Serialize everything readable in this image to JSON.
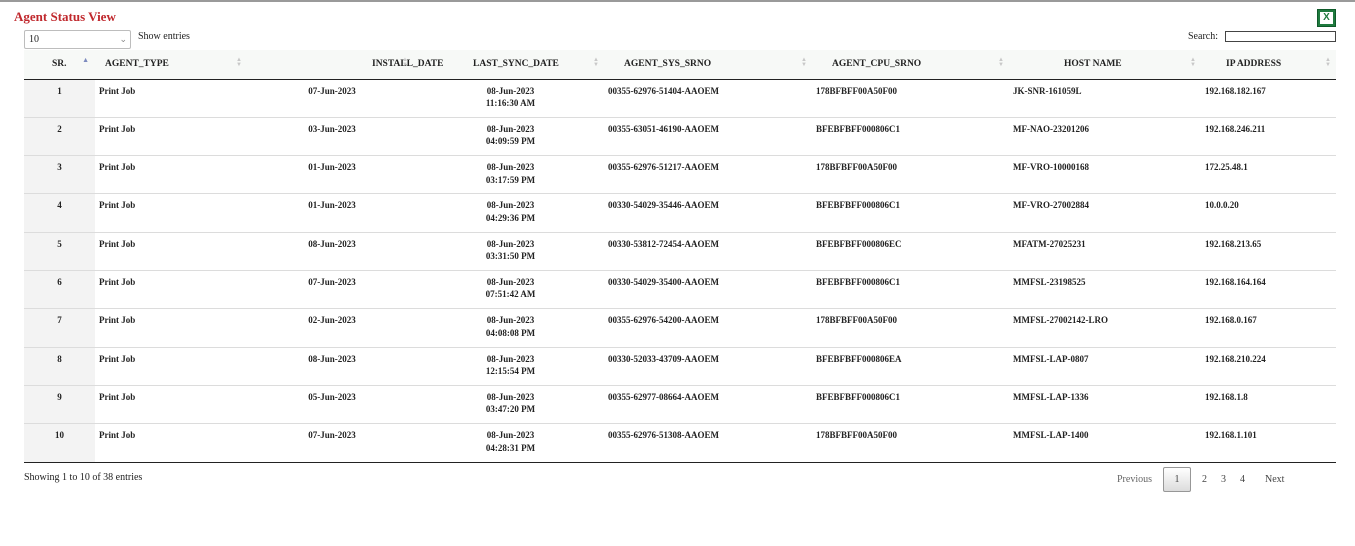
{
  "page": {
    "title": "Agent Status View",
    "export_icon": "excel-icon",
    "export_icon_letter": "X"
  },
  "controls": {
    "length_value": "10",
    "show_entries_label": "Show entries",
    "search_label": "Search:",
    "search_value": ""
  },
  "table": {
    "columns": [
      "SR.",
      "AGENT_TYPE",
      "INSTALL_DATE",
      "LAST_SYNC_DATE",
      "AGENT_SYS_SRNO",
      "AGENT_CPU_SRNO",
      "HOST NAME",
      "IP ADDRESS"
    ],
    "rows": [
      {
        "sr": "1",
        "type": "Print Job",
        "install": "07-Jun-2023",
        "sync_date": "08-Jun-2023",
        "sync_time": "11:16:30 AM",
        "sys": "00355-62976-51404-AAOEM",
        "cpu": "178BFBFF00A50F00",
        "host": "JK-SNR-161059L",
        "ip": "192.168.182.167"
      },
      {
        "sr": "2",
        "type": "Print Job",
        "install": "03-Jun-2023",
        "sync_date": "08-Jun-2023",
        "sync_time": "04:09:59 PM",
        "sys": "00355-63051-46190-AAOEM",
        "cpu": "BFEBFBFF000806C1",
        "host": "MF-NAO-23201206",
        "ip": "192.168.246.211"
      },
      {
        "sr": "3",
        "type": "Print Job",
        "install": "01-Jun-2023",
        "sync_date": "08-Jun-2023",
        "sync_time": "03:17:59 PM",
        "sys": "00355-62976-51217-AAOEM",
        "cpu": "178BFBFF00A50F00",
        "host": "MF-VRO-10000168",
        "ip": "172.25.48.1"
      },
      {
        "sr": "4",
        "type": "Print Job",
        "install": "01-Jun-2023",
        "sync_date": "08-Jun-2023",
        "sync_time": "04:29:36 PM",
        "sys": "00330-54029-35446-AAOEM",
        "cpu": "BFEBFBFF000806C1",
        "host": "MF-VRO-27002884",
        "ip": "10.0.0.20"
      },
      {
        "sr": "5",
        "type": "Print Job",
        "install": "08-Jun-2023",
        "sync_date": "08-Jun-2023",
        "sync_time": "03:31:50 PM",
        "sys": "00330-53812-72454-AAOEM",
        "cpu": "BFEBFBFF000806EC",
        "host": "MFATM-27025231",
        "ip": "192.168.213.65"
      },
      {
        "sr": "6",
        "type": "Print Job",
        "install": "07-Jun-2023",
        "sync_date": "08-Jun-2023",
        "sync_time": "07:51:42 AM",
        "sys": "00330-54029-35400-AAOEM",
        "cpu": "BFEBFBFF000806C1",
        "host": "MMFSL-23198525",
        "ip": "192.168.164.164"
      },
      {
        "sr": "7",
        "type": "Print Job",
        "install": "02-Jun-2023",
        "sync_date": "08-Jun-2023",
        "sync_time": "04:08:08 PM",
        "sys": "00355-62976-54200-AAOEM",
        "cpu": "178BFBFF00A50F00",
        "host": "MMFSL-27002142-LRO",
        "ip": "192.168.0.167"
      },
      {
        "sr": "8",
        "type": "Print Job",
        "install": "08-Jun-2023",
        "sync_date": "08-Jun-2023",
        "sync_time": "12:15:54 PM",
        "sys": "00330-52033-43709-AAOEM",
        "cpu": "BFEBFBFF000806EA",
        "host": "MMFSL-LAP-0807",
        "ip": "192.168.210.224"
      },
      {
        "sr": "9",
        "type": "Print Job",
        "install": "05-Jun-2023",
        "sync_date": "08-Jun-2023",
        "sync_time": "03:47:20 PM",
        "sys": "00355-62977-08664-AAOEM",
        "cpu": "BFEBFBFF000806C1",
        "host": "MMFSL-LAP-1336",
        "ip": "192.168.1.8"
      },
      {
        "sr": "10",
        "type": "Print Job",
        "install": "07-Jun-2023",
        "sync_date": "08-Jun-2023",
        "sync_time": "04:28:31 PM",
        "sys": "00355-62976-51308-AAOEM",
        "cpu": "178BFBFF00A50F00",
        "host": "MMFSL-LAP-1400",
        "ip": "192.168.1.101"
      }
    ]
  },
  "footer": {
    "info": "Showing 1 to 10 of 38 entries",
    "previous": "Previous",
    "pages": [
      "1",
      "2",
      "3",
      "4"
    ],
    "next": "Next"
  },
  "colors": {
    "title": "#c0282d",
    "excel": "#1f7a3e",
    "sort_active": "#7d8bbf"
  }
}
